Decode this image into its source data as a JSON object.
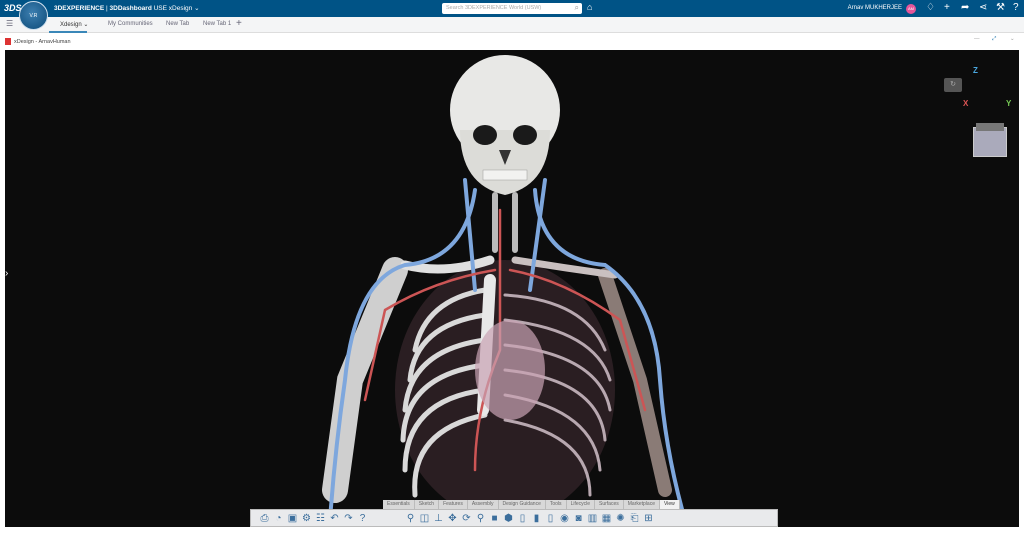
{
  "topbar": {
    "brand": "3DEXPERIENCE",
    "app": "3DDashboard",
    "dashboard": "USE xDesign",
    "search_placeholder": "Search 3DEXPERIENCE World (USW)",
    "user": "Arnav MUKHERJEE",
    "avatar": "AM",
    "compass_version": "V.R"
  },
  "tabs": [
    {
      "label": "Xdesign"
    },
    {
      "label": "My Communities"
    },
    {
      "label": "New Tab"
    },
    {
      "label": "New Tab 1"
    }
  ],
  "widget": {
    "title": "xDesign - ArnavHuman"
  },
  "axes": {
    "z": "Z",
    "x": "X",
    "y": "Y"
  },
  "toolbar_tabs": [
    "Essentials",
    "Sketch",
    "Features",
    "Assembly",
    "Design Guidance",
    "Tools",
    "Lifecycle",
    "Surfaces",
    "Marketplace",
    "View"
  ],
  "colors": {
    "topbar": "#005386",
    "accent": "#3a87b8"
  }
}
